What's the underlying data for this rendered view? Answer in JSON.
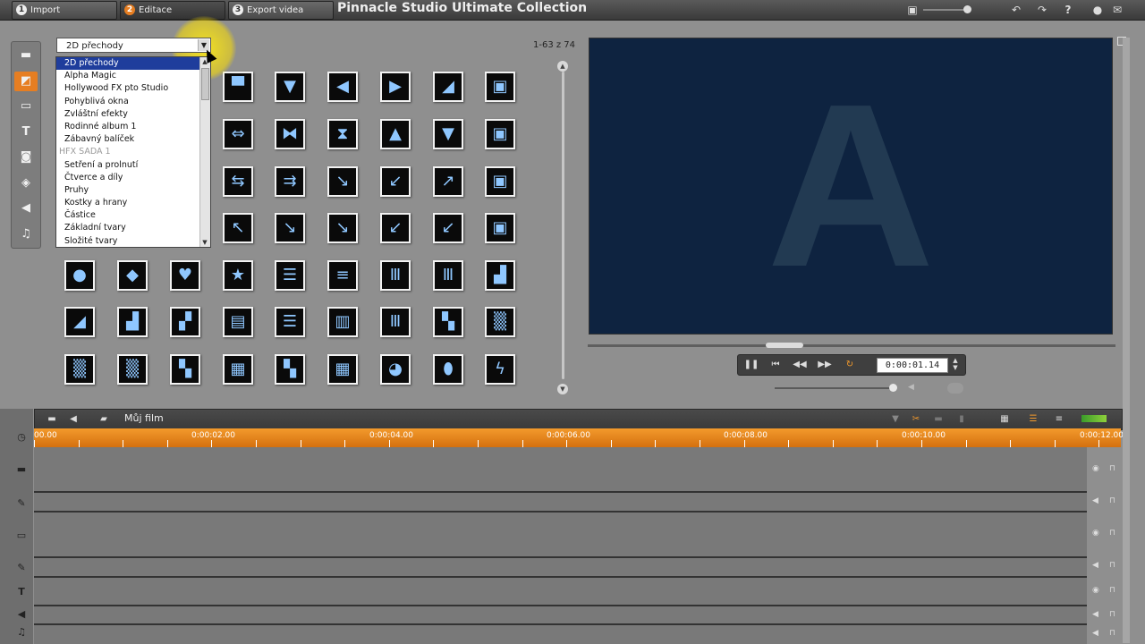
{
  "app": {
    "title": "Pinnacle Studio Ultimate Collection",
    "steps": [
      {
        "num": "1",
        "label": "Import"
      },
      {
        "num": "2",
        "label": "Editace"
      },
      {
        "num": "3",
        "label": "Export videa"
      }
    ],
    "toolbar_icons": [
      "undo-icon",
      "redo-icon",
      "help-icon",
      "lightbulb-icon",
      "mail-icon"
    ]
  },
  "library": {
    "categories": [
      "video-icon",
      "transition-icon",
      "menu-icon",
      "title-icon",
      "photo-icon",
      "effects-icon",
      "sound-icon",
      "music-icon"
    ],
    "active_category": 1,
    "combo_value": "2D přechody",
    "dropdown_items": [
      {
        "label": "2D přechody",
        "selected": true,
        "group": false
      },
      {
        "label": "Alpha Magic",
        "selected": false,
        "group": false
      },
      {
        "label": "Hollywood FX pto Studio",
        "selected": false,
        "group": false
      },
      {
        "label": "Pohyblivá okna",
        "selected": false,
        "group": false
      },
      {
        "label": "Zvláštní efekty",
        "selected": false,
        "group": false
      },
      {
        "label": "Rodinné album 1",
        "selected": false,
        "group": false
      },
      {
        "label": "Zábavný balíček",
        "selected": false,
        "group": false
      },
      {
        "label": "HFX SADA 1",
        "selected": false,
        "group": true
      },
      {
        "label": "Setření a prolnutí",
        "selected": false,
        "group": false
      },
      {
        "label": "Čtverce a díly",
        "selected": false,
        "group": false
      },
      {
        "label": "Pruhy",
        "selected": false,
        "group": false
      },
      {
        "label": "Kostky a hrany",
        "selected": false,
        "group": false
      },
      {
        "label": "Částice",
        "selected": false,
        "group": false
      },
      {
        "label": "Základní tvary",
        "selected": false,
        "group": false
      },
      {
        "label": "Složité tvary",
        "selected": false,
        "group": false
      }
    ],
    "count_label": "1-63 z 74"
  },
  "player": {
    "preview_letter": "A",
    "timecode": "0:00:01.14"
  },
  "timeline": {
    "title": "Můj film",
    "ruler_labels": [
      "00.00",
      "0:00:02.00",
      "0:00:04.00",
      "0:00:06.00",
      "0:00:08.00",
      "0:00:10.00",
      "0:00:12.00"
    ]
  }
}
